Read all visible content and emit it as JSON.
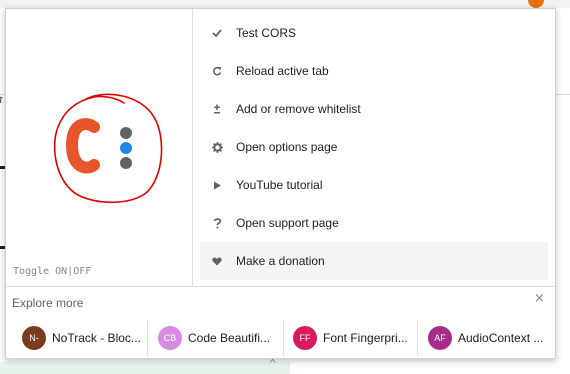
{
  "menu": {
    "items": [
      {
        "label": "Test CORS",
        "icon": "check-icon"
      },
      {
        "label": "Reload active tab",
        "icon": "reload-icon"
      },
      {
        "label": "Add or remove whitelist",
        "icon": "plus-minus-icon"
      },
      {
        "label": "Open options page",
        "icon": "gear-icon"
      },
      {
        "label": "YouTube tutorial",
        "icon": "play-icon"
      },
      {
        "label": "Open support page",
        "icon": "question-icon"
      },
      {
        "label": "Make a donation",
        "icon": "heart-icon"
      }
    ]
  },
  "toggle_label": "Toggle ON|OFF",
  "explore": {
    "title": "Explore more",
    "close_glyph": "×",
    "extensions": [
      {
        "initials": "N-",
        "name": "NoTrack - Bloc...",
        "color": "#7a3b1e"
      },
      {
        "initials": "CB",
        "name": "Code Beautifi...",
        "color": "#d58ce0"
      },
      {
        "initials": "FF",
        "name": "Font Fingerpri...",
        "color": "#d81b60"
      },
      {
        "initials": "AF",
        "name": "AudioContext ...",
        "color": "#a82d8a"
      }
    ]
  },
  "background": {
    "close_glyph": "×",
    "fragment_glyph": "ז"
  },
  "colors": {
    "logo_orange": "#e8552a",
    "logo_gray": "#5f6368",
    "logo_blue": "#1e88e5",
    "annotation_red": "#e00000"
  }
}
